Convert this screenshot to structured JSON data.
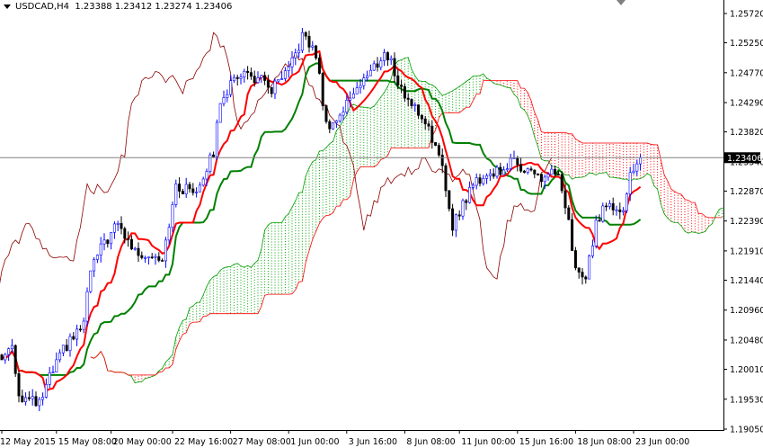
{
  "header": {
    "symbol": "USDCAD,H4",
    "open": "1.23388",
    "high": "1.23412",
    "low": "1.23274",
    "close": "1.23406"
  },
  "chart_data": {
    "type": "candlestick",
    "title": "USDCAD,H4",
    "indicator": "Ichimoku Kinko Hyo (9, 26, 52)",
    "last_price": 1.23406,
    "last_price_label": "1.23406",
    "ylim": [
      1.1905,
      1.2572
    ],
    "y_ticks": [
      "1.25720",
      "1.25250",
      "1.24770",
      "1.24290",
      "1.23820",
      "1.23340",
      "1.22870",
      "1.22390",
      "1.21910",
      "1.21440",
      "1.20960",
      "1.20480",
      "1.20010",
      "1.19530",
      "1.19050"
    ],
    "x_ticks": [
      {
        "bar": 0,
        "label": "12 May 2015"
      },
      {
        "bar": 16,
        "label": "15 May 08:00"
      },
      {
        "bar": 32,
        "label": "20 May 00:00"
      },
      {
        "bar": 50,
        "label": "22 May 16:00"
      },
      {
        "bar": 67,
        "label": "27 May 08:00"
      },
      {
        "bar": 84,
        "label": "1 Jun 00:00"
      },
      {
        "bar": 101,
        "label": "3 Jun 16:00"
      },
      {
        "bar": 118,
        "label": "8 Jun 08:00"
      },
      {
        "bar": 134,
        "label": "11 Jun 00:00"
      },
      {
        "bar": 151,
        "label": "15 Jun 16:00"
      },
      {
        "bar": 168,
        "label": "18 Jun 08:00"
      },
      {
        "bar": 185,
        "label": "23 Jun 00:00"
      }
    ],
    "close_path": [
      [
        0,
        1.2016
      ],
      [
        3,
        1.2045
      ],
      [
        5,
        1.1958
      ],
      [
        11,
        1.1944
      ],
      [
        14,
        1.1987
      ],
      [
        18,
        1.2031
      ],
      [
        24,
        1.2074
      ],
      [
        26,
        1.2161
      ],
      [
        30,
        1.2204
      ],
      [
        34,
        1.2233
      ],
      [
        39,
        1.2189
      ],
      [
        47,
        1.2182
      ],
      [
        51,
        1.229
      ],
      [
        57,
        1.229
      ],
      [
        62,
        1.2348
      ],
      [
        64,
        1.2435
      ],
      [
        70,
        1.2478
      ],
      [
        76,
        1.2464
      ],
      [
        79,
        1.2449
      ],
      [
        84,
        1.2478
      ],
      [
        88,
        1.2536
      ],
      [
        92,
        1.2507
      ],
      [
        95,
        1.2392
      ],
      [
        99,
        1.2406
      ],
      [
        103,
        1.2449
      ],
      [
        108,
        1.2478
      ],
      [
        112,
        1.2507
      ],
      [
        114,
        1.2493
      ],
      [
        117,
        1.2449
      ],
      [
        121,
        1.242
      ],
      [
        125,
        1.2392
      ],
      [
        129,
        1.2319
      ],
      [
        132,
        1.2233
      ],
      [
        136,
        1.2276
      ],
      [
        139,
        1.2305
      ],
      [
        145,
        1.2319
      ],
      [
        150,
        1.2334
      ],
      [
        155,
        1.2319
      ],
      [
        158,
        1.2305
      ],
      [
        161,
        1.2319
      ],
      [
        163,
        1.2305
      ],
      [
        166,
        1.2233
      ],
      [
        168,
        1.2161
      ],
      [
        171,
        1.2146
      ],
      [
        174,
        1.2233
      ],
      [
        176,
        1.2262
      ],
      [
        182,
        1.2262
      ],
      [
        184,
        1.2312
      ],
      [
        187,
        1.23406
      ]
    ],
    "colors": {
      "bull": "#0000ff",
      "bear": "#000000",
      "tenkan": "#ff0000",
      "kijun": "#008000",
      "chikou": "#8b0000",
      "cloud_up": "#00a000",
      "cloud_down": "#ff0000"
    }
  }
}
